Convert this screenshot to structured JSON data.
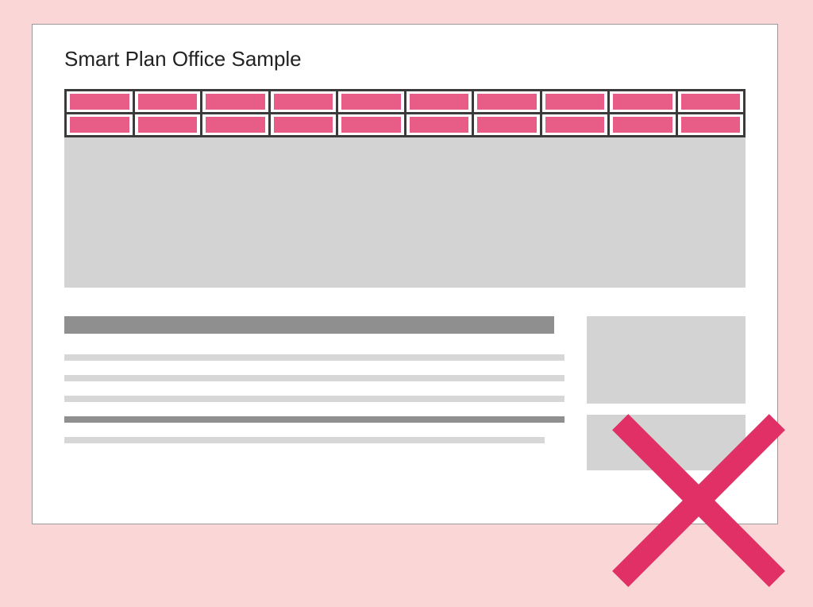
{
  "title": "Smart Plan Office Sample",
  "nav": {
    "rows": 2,
    "cols": 10,
    "cell_color": "#e85d87",
    "border_color": "#3b3b3b"
  },
  "article": {
    "lines": [
      {
        "kind": "title"
      },
      {
        "kind": "light"
      },
      {
        "kind": "light"
      },
      {
        "kind": "light"
      },
      {
        "kind": "dark"
      },
      {
        "kind": "light"
      }
    ]
  },
  "sidebar_boxes": 2,
  "overlay": {
    "name": "reject-cross",
    "color": "#e13066"
  },
  "palette": {
    "page_bg": "#fad6d6",
    "card_bg": "#ffffff",
    "placeholder_grey": "#d3d3d3",
    "dark_grey": "#8f8f8f"
  }
}
